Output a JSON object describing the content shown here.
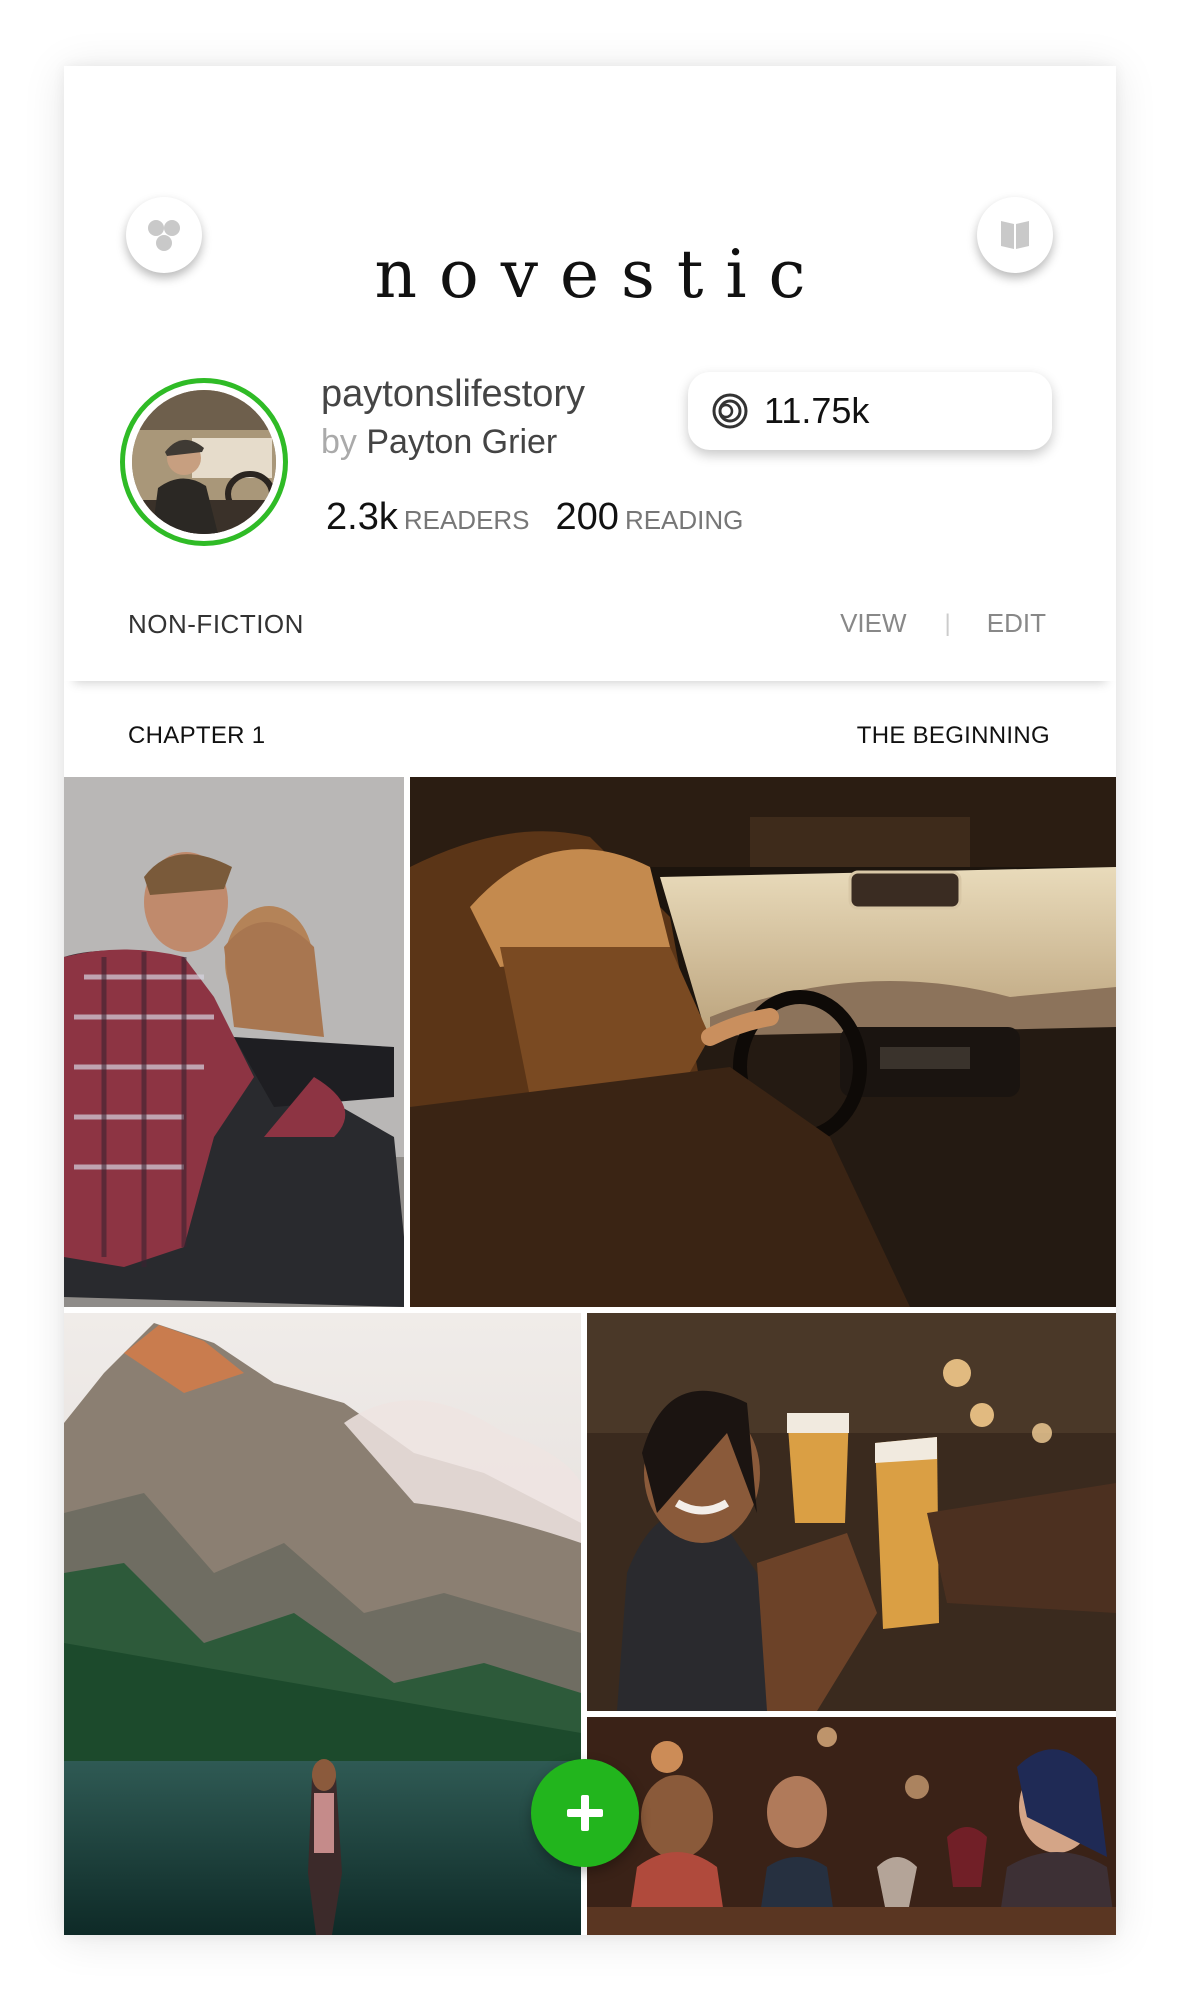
{
  "app": {
    "logo": "novestic"
  },
  "profile": {
    "username": "paytonslifestory",
    "by_prefix": "by",
    "author": "Payton Grier",
    "readers_count": "2.3k",
    "readers_label": "READERS",
    "reading_count": "200",
    "reading_label": "READING"
  },
  "coins": {
    "value": "11.75k",
    "icon": "coin-rings-icon"
  },
  "story": {
    "genre": "NON-FICTION",
    "view_label": "VIEW",
    "separator": "|",
    "edit_label": "EDIT"
  },
  "chapter": {
    "number": "CHAPTER 1",
    "title": "THE BEGINNING"
  },
  "gallery": [
    {
      "subject": "couple-sitting-photo"
    },
    {
      "subject": "driving-car-photo"
    },
    {
      "subject": "mountain-lake-photo"
    },
    {
      "subject": "friends-toasting-beer-photo"
    },
    {
      "subject": "friends-dinner-wine-photo"
    }
  ],
  "colors": {
    "accent_green": "#22b51d",
    "avatar_ring": "#2fbb26"
  },
  "icons": {
    "left_button": "three-dots-cluster-icon",
    "right_button": "book-icon",
    "fab": "plus-icon"
  }
}
